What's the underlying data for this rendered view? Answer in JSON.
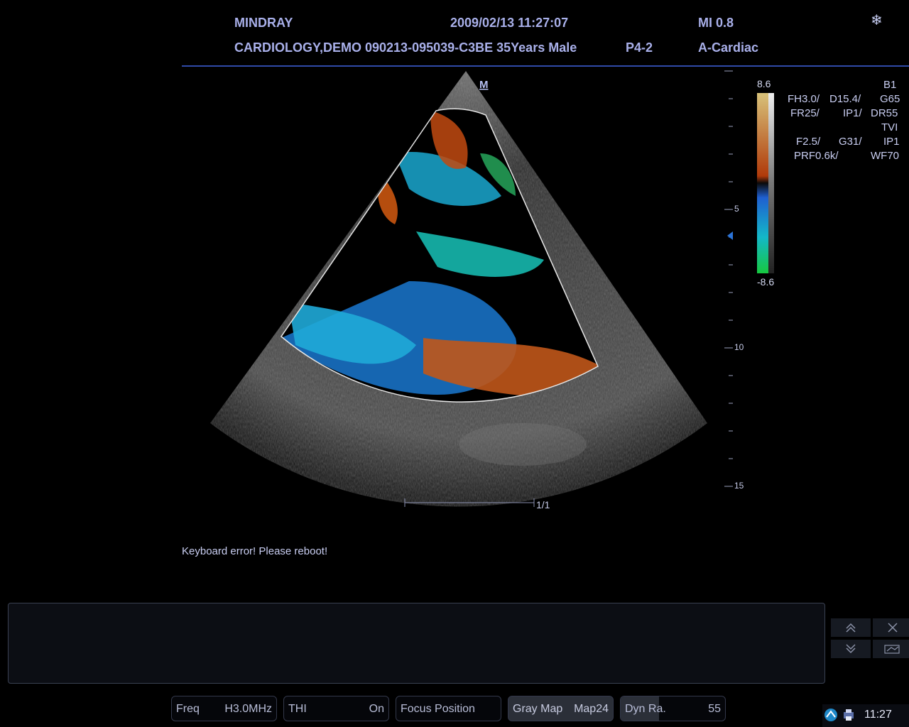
{
  "header": {
    "brand": "MINDRAY",
    "datetime": "2009/02/13 11:27:07",
    "mi": "MI 0.8",
    "patient": "CARDIOLOGY,DEMO 090213-095039-C3BE 35Years Male",
    "probe": "P4-2",
    "exam": "A-Cardiac"
  },
  "image": {
    "orientation_mark": "M",
    "frame_counter": "1/1",
    "depth_labels": [
      "5",
      "10",
      "15"
    ]
  },
  "colorbar": {
    "max": "8.6",
    "min": "-8.6",
    "colors": {
      "top": "#e8d8a0",
      "positive": "#b8420f",
      "negative": "#1f5fd0",
      "bottom": "#18c850"
    }
  },
  "params": {
    "b1": "B1",
    "fh": "FH3.0/",
    "d": "D15.4/",
    "g": "G65",
    "fr": "FR25/",
    "ip1": "IP1/",
    "dr": "DR55",
    "tvi": "TVI",
    "f": "F2.5/",
    "g31": "G31/",
    "ip": "IP1",
    "prf": "PRF0.6k/",
    "wf": "WF70"
  },
  "message": "Keyboard error! Please reboot!",
  "nav": {
    "up_icon": "chevrons-up-icon",
    "close_icon": "close-icon",
    "down_icon": "chevrons-down-icon",
    "export_icon": "export-icon"
  },
  "controls": [
    {
      "label": "Freq",
      "value": "H3.0MHz"
    },
    {
      "label": "THI",
      "value": "On"
    },
    {
      "label": "Focus Position",
      "value": ""
    },
    {
      "label": "Gray Map",
      "value": "Map24"
    },
    {
      "label": "Dyn Ra.",
      "value": "55"
    }
  ],
  "tray": {
    "clock": "11:27",
    "icons": [
      "network-icon",
      "printer-icon"
    ]
  }
}
